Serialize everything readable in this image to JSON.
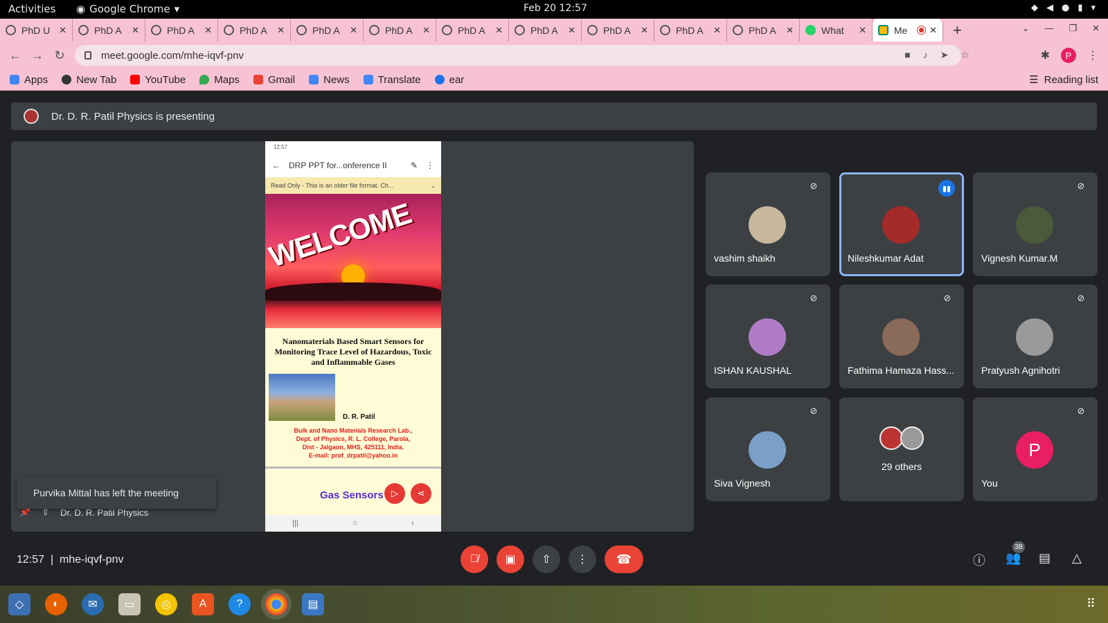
{
  "system": {
    "activities": "Activities",
    "app_name": "Google Chrome",
    "clock": "Feb 20  12:57"
  },
  "tabs": [
    {
      "label": "PhD U"
    },
    {
      "label": "PhD A"
    },
    {
      "label": "PhD A"
    },
    {
      "label": "PhD A"
    },
    {
      "label": "PhD A"
    },
    {
      "label": "PhD A"
    },
    {
      "label": "PhD A"
    },
    {
      "label": "PhD A"
    },
    {
      "label": "PhD A"
    },
    {
      "label": "PhD A"
    },
    {
      "label": "PhD A"
    },
    {
      "label": "What"
    },
    {
      "label": "Me"
    }
  ],
  "address": {
    "url": "meet.google.com/mhe-iqvf-pnv",
    "profile_initial": "P"
  },
  "bookmarks": [
    {
      "label": "Apps",
      "color": "#4285f4"
    },
    {
      "label": "New Tab",
      "color": "#333333"
    },
    {
      "label": "YouTube",
      "color": "#ff0000"
    },
    {
      "label": "Maps",
      "color": "#34a853"
    },
    {
      "label": "Gmail",
      "color": "#ea4335"
    },
    {
      "label": "News",
      "color": "#4285f4"
    },
    {
      "label": "Translate",
      "color": "#4285f4"
    },
    {
      "label": "ear",
      "color": "#1a73e8"
    }
  ],
  "reading_list": "Reading list",
  "presenting": "Dr. D. R. Patil Physics is presenting",
  "slide": {
    "status_time": "12:57",
    "doc_title": "DRP PPT for...onference II",
    "warning": "Read Only - This is an older file format. Ch...",
    "welcome": "WELCOME",
    "title": "Nanomaterials Based Smart Sensors for Monitoring Trace Level of Hazardous, Toxic and Inflammable Gases",
    "author": "D. R. Patil",
    "addr1": "Bulk and Nano Materials Research Lab.,",
    "addr2": "Dept. of Physics, R. L. College, Parola,",
    "addr3": "Dist - Jalgaon, MHS, 425111, India.",
    "addr4": "E-mail: prof_drpatil@yahoo.in",
    "footer": "Gas Sensors"
  },
  "toast": "Purvika Mittal has left the meeting",
  "presenter_label": "Dr. D. R. Patil Physics",
  "participants": [
    {
      "name": "vashim shaikh",
      "color": "#c9b79c",
      "muted": true
    },
    {
      "name": "Nileshkumar Adat",
      "color": "#a52a2a",
      "muted": false,
      "speaking": true
    },
    {
      "name": "Vignesh Kumar.M",
      "color": "#4a5a3a",
      "muted": true
    },
    {
      "name": "ISHAN KAUSHAL",
      "color": "#b07cc6",
      "muted": true
    },
    {
      "name": "Fathima Hamaza Hass...",
      "color": "#8a6a58",
      "muted": true
    },
    {
      "name": "Pratyush Agnihotri",
      "color": "#9a9a9a",
      "muted": true
    },
    {
      "name": "Siva Vignesh",
      "color": "#7aa0c8",
      "muted": true
    },
    {
      "name": "29 others",
      "color": "#3c4043",
      "muted": false
    },
    {
      "name": "You",
      "color": "#e91e63",
      "muted": true,
      "initial": "P"
    }
  ],
  "bottom": {
    "time": "12:57",
    "code": "mhe-iqvf-pnv",
    "participant_count": "38"
  }
}
